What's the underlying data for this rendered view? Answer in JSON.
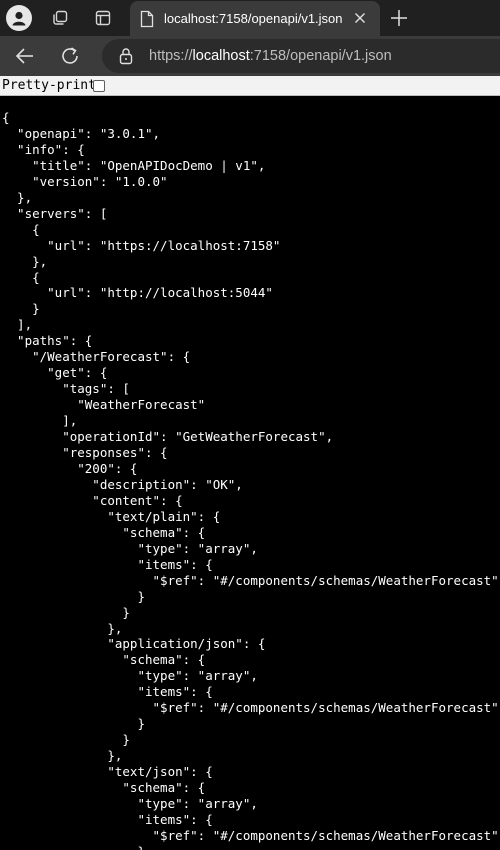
{
  "browser": {
    "tab_title": "localhost:7158/openapi/v1.json",
    "url_scheme": "https://",
    "url_host": "localhost",
    "url_rest": ":7158/openapi/v1.json"
  },
  "pretty_print": {
    "label": "Pretty-print",
    "checked": false
  },
  "json_lines": [
    "{",
    "  \"openapi\": \"3.0.1\",",
    "  \"info\": {",
    "    \"title\": \"OpenAPIDocDemo | v1\",",
    "    \"version\": \"1.0.0\"",
    "  },",
    "  \"servers\": [",
    "    {",
    "      \"url\": \"https://localhost:7158\"",
    "    },",
    "    {",
    "      \"url\": \"http://localhost:5044\"",
    "    }",
    "  ],",
    "  \"paths\": {",
    "    \"/WeatherForecast\": {",
    "      \"get\": {",
    "        \"tags\": [",
    "          \"WeatherForecast\"",
    "        ],",
    "        \"operationId\": \"GetWeatherForecast\",",
    "        \"responses\": {",
    "          \"200\": {",
    "            \"description\": \"OK\",",
    "            \"content\": {",
    "              \"text/plain\": {",
    "                \"schema\": {",
    "                  \"type\": \"array\",",
    "                  \"items\": {",
    "                    \"$ref\": \"#/components/schemas/WeatherForecast\"",
    "                  }",
    "                }",
    "              },",
    "              \"application/json\": {",
    "                \"schema\": {",
    "                  \"type\": \"array\",",
    "                  \"items\": {",
    "                    \"$ref\": \"#/components/schemas/WeatherForecast\"",
    "                  }",
    "                }",
    "              },",
    "              \"text/json\": {",
    "                \"schema\": {",
    "                  \"type\": \"array\",",
    "                  \"items\": {",
    "                    \"$ref\": \"#/components/schemas/WeatherForecast\"",
    "                  }"
  ],
  "colors": {
    "tabstrip": "#202020",
    "active_tab": "#3b3b3b",
    "omnibox": "#2b2b2b",
    "content_bg": "#000000",
    "text": "#ffffff"
  },
  "icons": [
    "profile-icon",
    "workspaces-icon",
    "tab-actions-icon",
    "page-icon",
    "close-icon",
    "new-tab-icon",
    "back-icon",
    "refresh-icon",
    "lock-icon"
  ]
}
